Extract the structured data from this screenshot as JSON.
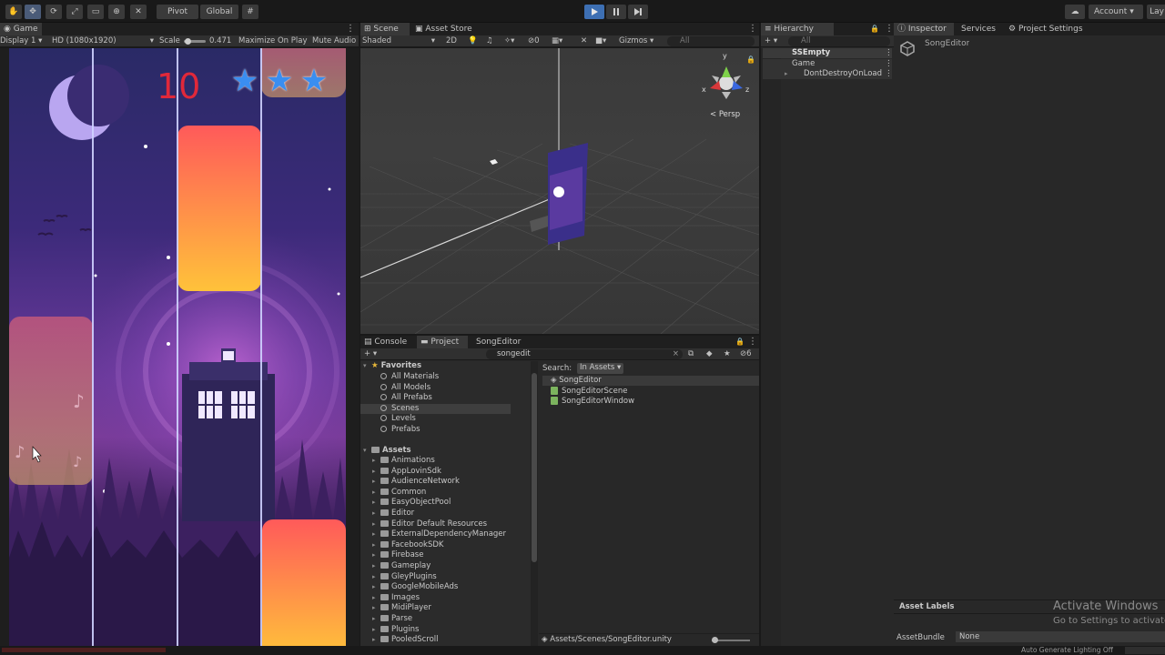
{
  "toolbar": {
    "pivot_label": "Pivot",
    "global_label": "Global",
    "account_label": "Account",
    "layout_label": "Lay"
  },
  "game": {
    "tab_label": "Game",
    "display_label": "Display 1",
    "resolution_label": "HD (1080x1920)",
    "scale_label": "Scale",
    "scale_value": "0.471",
    "maximize_label": "Maximize On Play",
    "mute_label": "Mute Audio",
    "score": "10",
    "stars": 3
  },
  "scene": {
    "tab_label": "Scene",
    "asset_store_label": "Asset Store",
    "shading_label": "Shaded",
    "mode_2d_label": "2D",
    "gizmos_label": "Gizmos",
    "search_placeholder": "All",
    "persp_label": "< Persp",
    "axis_x": "x",
    "axis_y": "y",
    "axis_z": "z",
    "hidden_count": "0"
  },
  "hierarchy": {
    "tab_label": "Hierarchy",
    "search_placeholder": "All",
    "items": [
      {
        "label": "SSEmpty"
      },
      {
        "label": "Game"
      },
      {
        "label": "DontDestroyOnLoad"
      }
    ]
  },
  "inspector": {
    "tab_label": "Inspector",
    "services_label": "Services",
    "project_settings_label": "Project Settings",
    "object_name": "SongEditor",
    "asset_labels": "Asset Labels",
    "asset_bundle_label": "AssetBundle",
    "asset_bundle_value": "None"
  },
  "project": {
    "console_label": "Console",
    "project_label": "Project",
    "songeditor_label": "SongEditor",
    "search_value": "songedit",
    "filter_count": "6",
    "favorites_label": "Favorites",
    "favorites": [
      "All Materials",
      "All Models",
      "All Prefabs",
      "Scenes",
      "Levels",
      "Prefabs"
    ],
    "assets_label": "Assets",
    "asset_folders": [
      "Animations",
      "AppLovinSdk",
      "AudienceNetwork",
      "Common",
      "EasyObjectPool",
      "Editor",
      "Editor Default Resources",
      "ExternalDependencyManager",
      "FacebookSDK",
      "Firebase",
      "Gameplay",
      "GleyPlugins",
      "GoogleMobileAds",
      "Images",
      "MidiPlayer",
      "Parse",
      "Plugins",
      "PooledScroll"
    ],
    "search_label": "Search:",
    "search_scope": "In Assets",
    "results": [
      {
        "label": "SongEditor",
        "icon": "unity-icon"
      },
      {
        "label": "SongEditorScene",
        "icon": "script-icon"
      },
      {
        "label": "SongEditorWindow",
        "icon": "script-icon"
      }
    ],
    "footer_path": "Assets/Scenes/SongEditor.unity"
  },
  "watermark": {
    "title": "Activate Windows",
    "subtitle": "Go to Settings to activate"
  },
  "status": {
    "right_text": "Auto Generate Lighting Off"
  },
  "colors": {
    "accent": "#3d6fb3",
    "tile_top": "#ff5a5a",
    "tile_bottom": "#ffc23a",
    "star": "#3a8ef0",
    "score": "#e0283a"
  }
}
